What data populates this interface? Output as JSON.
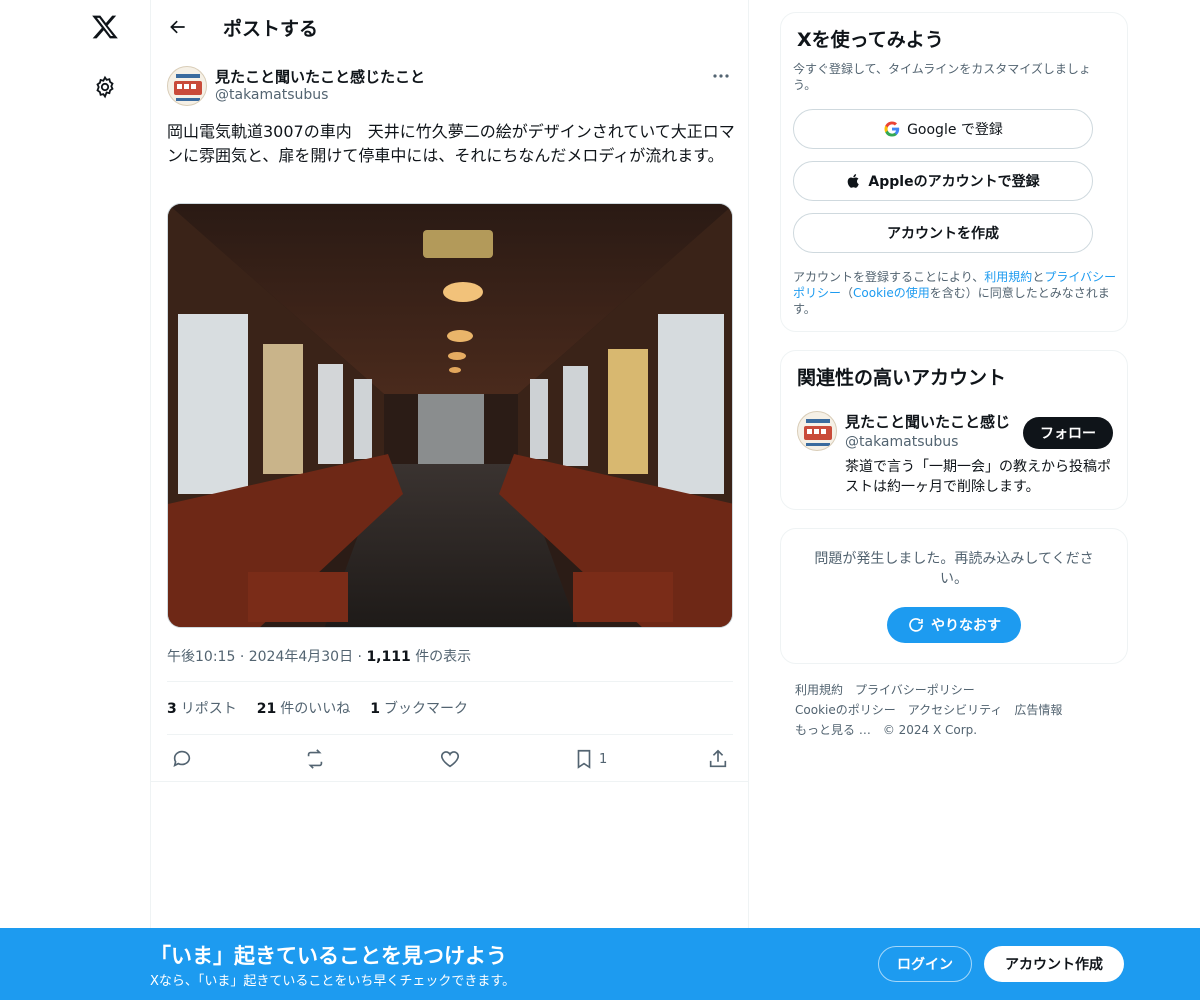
{
  "header": {
    "title": "ポストする"
  },
  "tweet": {
    "author_name": "見たこと聞いたこと感じたこと",
    "author_handle": "@takamatsubus",
    "text": "岡山電気軌道3007の車内　天井に竹久夢二の絵がデザインされていて大正ロマンに雰囲気と、扉を開けて停車中には、それにちなんだメロディが流れます。",
    "time": "午後10:15",
    "date": "2024年4月30日",
    "views_count": "1,111",
    "views_label": "件の表示",
    "retweets_count": "3",
    "retweets_label": "リポスト",
    "likes_count": "21",
    "likes_label": "件のいいね",
    "bookmarks_count": "1",
    "bookmarks_label": "ブックマーク",
    "bookmark_action_count": "1"
  },
  "signup_card": {
    "title": "Xを使ってみよう",
    "subtitle": "今すぐ登録して、タイムラインをカスタマイズしましょう。",
    "google_label": "Google で登録",
    "apple_label": "Appleのアカウントで登録",
    "create_label": "アカウントを作成",
    "terms_prefix": "アカウントを登録することにより、",
    "terms_link": "利用規約",
    "terms_and": "と",
    "privacy_link": "プライバシーポリシー",
    "terms_mid": "（",
    "cookie_link": "Cookieの使用",
    "terms_suffix": "を含む）に同意したとみなされます。"
  },
  "related_card": {
    "title": "関連性の高いアカウント",
    "name": "見たこと聞いたこと感じ",
    "handle": "@takamatsubus",
    "follow_label": "フォロー",
    "bio": "茶道で言う「一期一会」の教えから投稿ポストは約一ヶ月で削除します。"
  },
  "error_card": {
    "message": "問題が発生しました。再読み込みしてください。",
    "retry_label": "やりなおす"
  },
  "footer": {
    "links": [
      "利用規約",
      "プライバシーポリシー",
      "Cookieのポリシー",
      "アクセシビリティ",
      "広告情報",
      "もっと見る …"
    ],
    "copyright": "© 2024 X Corp."
  },
  "banner": {
    "title": "「いま」起きていることを見つけよう",
    "subtitle": "Xなら、「いま」起きていることをいち早くチェックできます。",
    "login_label": "ログイン",
    "signup_label": "アカウント作成"
  },
  "colors": {
    "accent": "#1d9bf0",
    "text": "#0f1419",
    "muted": "#536471"
  }
}
